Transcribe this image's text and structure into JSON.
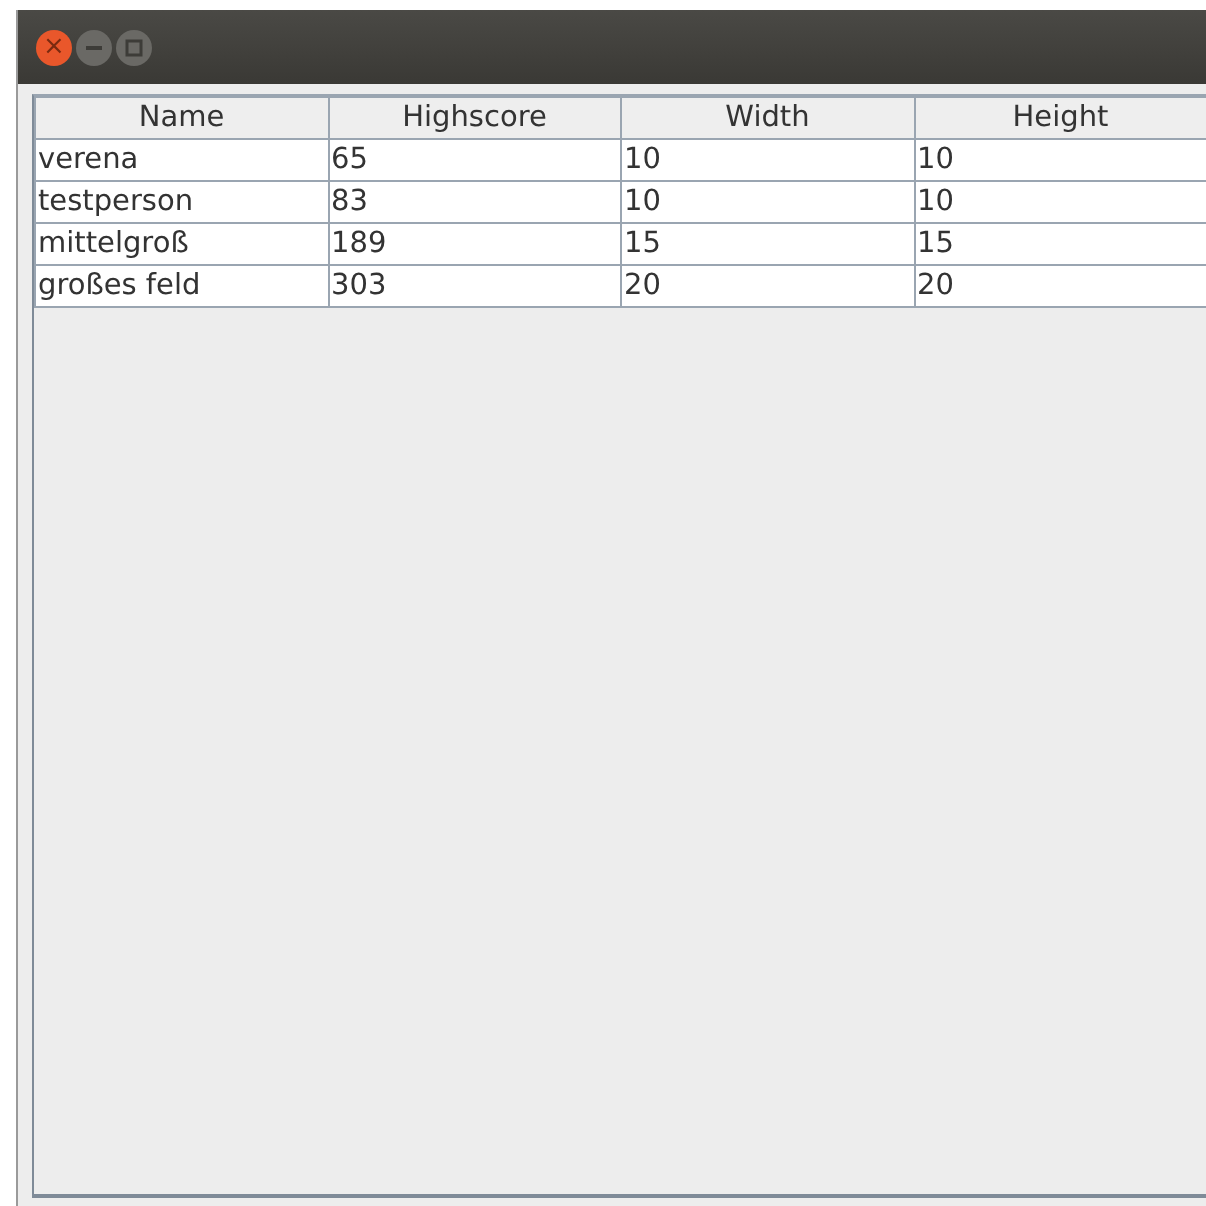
{
  "window": {
    "buttons": [
      {
        "kind": "close",
        "label": "×"
      },
      {
        "kind": "minimize"
      },
      {
        "kind": "maximize"
      }
    ]
  },
  "table": {
    "columns": [
      "Name",
      "Highscore",
      "Width",
      "Height"
    ],
    "rows": [
      [
        "verena",
        "65",
        "10",
        "10"
      ],
      [
        "testperson",
        "83",
        "10",
        "10"
      ],
      [
        "mittelgroß",
        "189",
        "15",
        "15"
      ],
      [
        "großes feld",
        "303",
        "20",
        "20"
      ]
    ]
  }
}
